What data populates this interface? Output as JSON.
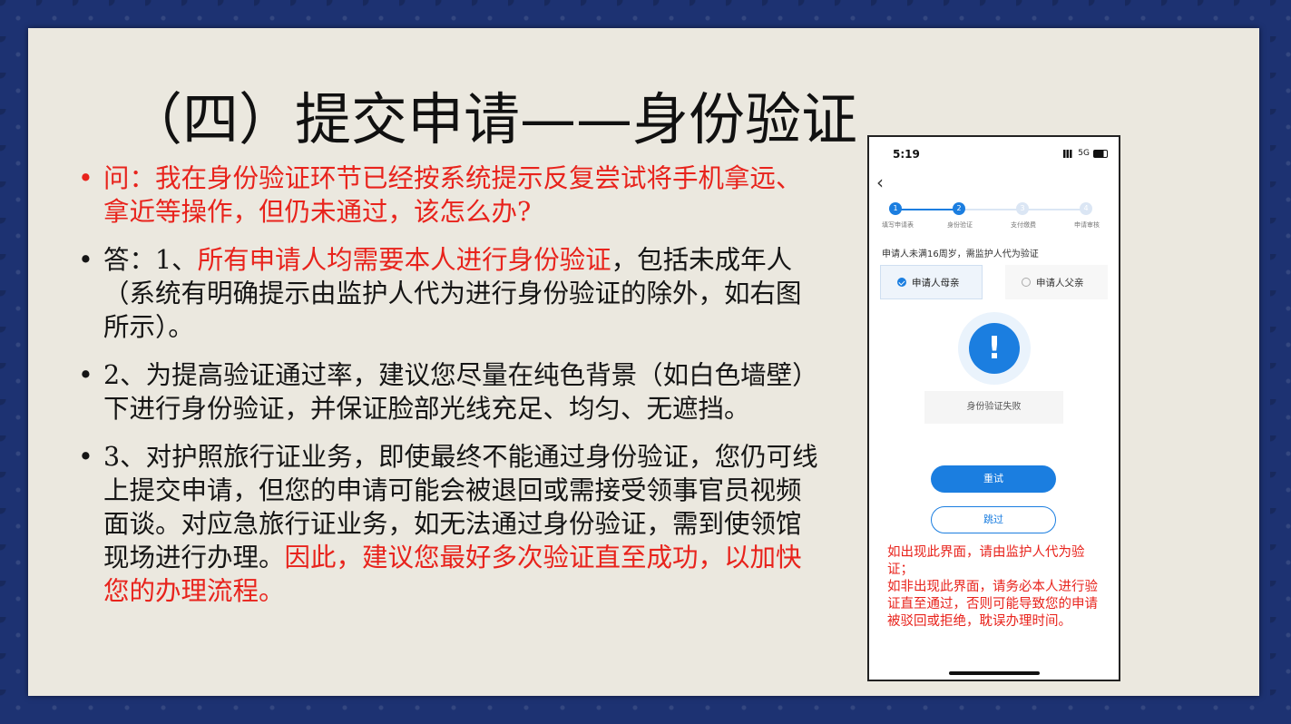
{
  "title": "（四）提交申请——身份验证",
  "bullets": [
    {
      "dot": "•",
      "parts": [
        {
          "text": "问：我在身份验证环节已经按系统提示反复尝试将手机拿远、拿近等操作，但仍未通过，该怎么办?",
          "color": "red"
        }
      ]
    },
    {
      "dot": "•",
      "parts": [
        {
          "text": "答：1、",
          "color": "black"
        },
        {
          "text": "所有申请人均需要本人进行身份验证",
          "color": "red"
        },
        {
          "text": "，包括未成年人（系统有明确提示由监护人代为进行身份验证的除外，如右图所示）。",
          "color": "black"
        }
      ]
    },
    {
      "dot": "•",
      "parts": [
        {
          "text": "2、为提高验证通过率，建议您尽量在纯色背景（如白色墙壁）下进行身份验证，并保证脸部光线充足、均匀、无遮挡。",
          "color": "black"
        }
      ]
    },
    {
      "dot": "•",
      "parts": [
        {
          "text": "3、对护照旅行证业务，即使最终不能通过身份验证，您仍可线上提交申请，但您的申请可能会被退回或需接受领事官员视频面谈。对应急旅行证业务，如无法通过身份验证，需到使领馆现场进行办理。",
          "color": "black"
        },
        {
          "text": "因此，建议您最好多次验证直至成功，以加快您的办理流程。",
          "color": "red"
        }
      ]
    }
  ],
  "phone": {
    "time": "5:19",
    "network": "5G",
    "back_icon": "chevron-left-icon",
    "steps": [
      {
        "num": "1",
        "label": "填写申请表",
        "done": true
      },
      {
        "num": "2",
        "label": "身份验证",
        "done": true
      },
      {
        "num": "3",
        "label": "支付缴费",
        "done": false
      },
      {
        "num": "4",
        "label": "申请审核",
        "done": false
      }
    ],
    "note": "申请人未满16周岁，需监护人代为验证",
    "option_mother": "申请人母亲",
    "option_father": "申请人父亲",
    "alert_symbol": "!",
    "fail_text": "身份验证失败",
    "retry_label": "重试",
    "skip_label": "跳过"
  },
  "tip": {
    "line1": "如出现此界面，请由监护人代为验证；",
    "line2": "如非出现此界面，请务必本人进行验证直至通过，否则可能导致您的申请被驳回或拒绝，耽误办理时间。"
  },
  "colors": {
    "red": "#e8231c",
    "accent": "#1b7ee0",
    "frame": "#1d3272",
    "paper": "#ebe8df"
  }
}
